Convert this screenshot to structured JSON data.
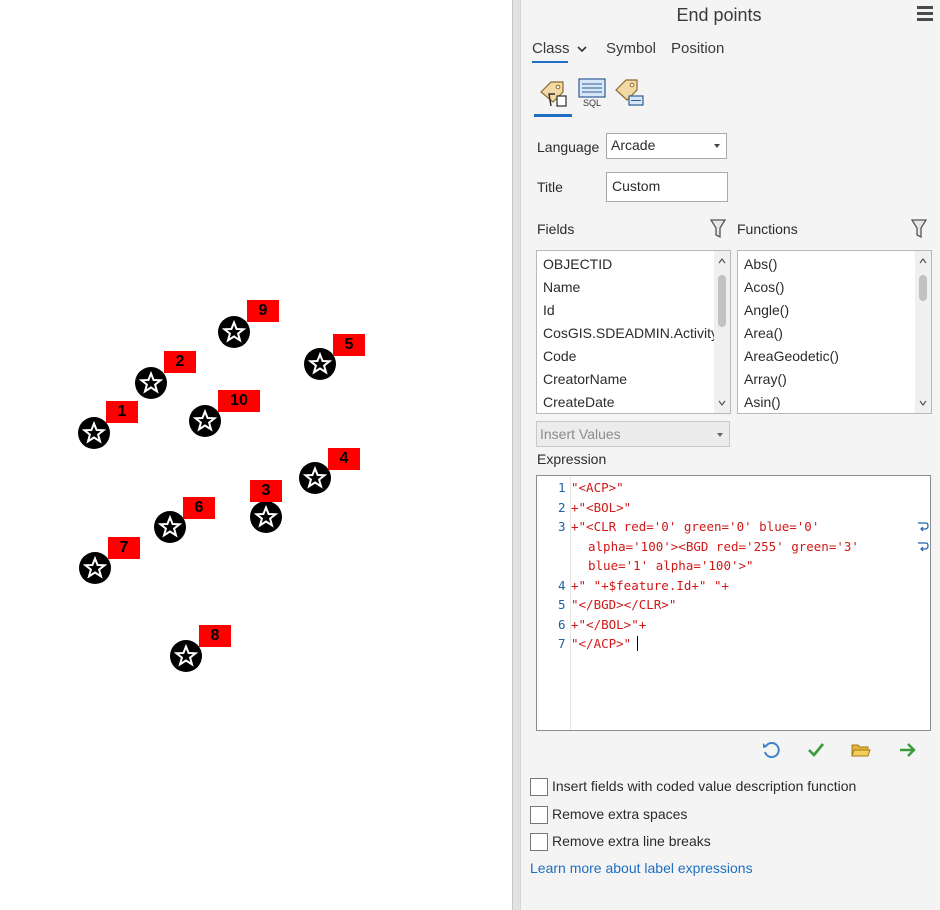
{
  "panel": {
    "title": "End points",
    "tabs": [
      {
        "label": "Class",
        "active": true
      },
      {
        "label": "Symbol",
        "active": false
      },
      {
        "label": "Position",
        "active": false
      }
    ],
    "tools": [
      "expression-tool-icon",
      "sql-tool-icon",
      "label-class-tool-icon"
    ],
    "sql_text": "SQL",
    "language": {
      "label": "Language",
      "value": "Arcade"
    },
    "title_field": {
      "label": "Title",
      "value": "Custom"
    },
    "fields": {
      "label": "Fields",
      "items": [
        "OBJECTID",
        "Name",
        "Id",
        "CosGIS.SDEADMIN.Activity",
        "Code",
        "CreatorName",
        "CreateDate"
      ]
    },
    "functions": {
      "label": "Functions",
      "items": [
        "Abs()",
        "Acos()",
        "Angle()",
        "Area()",
        "AreaGeodetic()",
        "Array()",
        "Asin()"
      ]
    },
    "insert_values": {
      "placeholder": "Insert Values"
    },
    "expression": {
      "label": "Expression",
      "line_numbers": [
        "1",
        "2",
        "3",
        "4",
        "5",
        "6",
        "7"
      ],
      "lines": [
        "\"<ACP>\"",
        "+\"<BOL>\"",
        "+\"<CLR red='0' green='0' blue='0'",
        "alpha='100'><BGD red='255' green='3'",
        "blue='1' alpha='100'>\"",
        "+\" \"+$feature.Id+\" \"+",
        "\"</BGD></CLR>\"",
        "+\"</BOL>\"+",
        "\"</ACP>\""
      ]
    },
    "actions": [
      "reset-icon",
      "verify-icon",
      "open-icon",
      "apply-icon"
    ],
    "options": [
      {
        "label": "Insert fields with coded value description function",
        "checked": false
      },
      {
        "label": "Remove extra spaces",
        "checked": false
      },
      {
        "label": "Remove extra line breaks",
        "checked": false
      }
    ],
    "link": "Learn more about label expressions"
  },
  "map": {
    "points": [
      {
        "label": "1"
      },
      {
        "label": "2"
      },
      {
        "label": "3"
      },
      {
        "label": "4"
      },
      {
        "label": "5"
      },
      {
        "label": "6"
      },
      {
        "label": "7"
      },
      {
        "label": "8"
      },
      {
        "label": "9"
      },
      {
        "label": "10"
      }
    ],
    "symbol_icon": "star-icon",
    "colors": {
      "label_bg": "#ff0000",
      "symbol": "#000000"
    }
  },
  "colors": {
    "accent": "#1f6ec1",
    "string": "#d01818",
    "variable": "#15803d",
    "line_number": "#2060a8"
  }
}
